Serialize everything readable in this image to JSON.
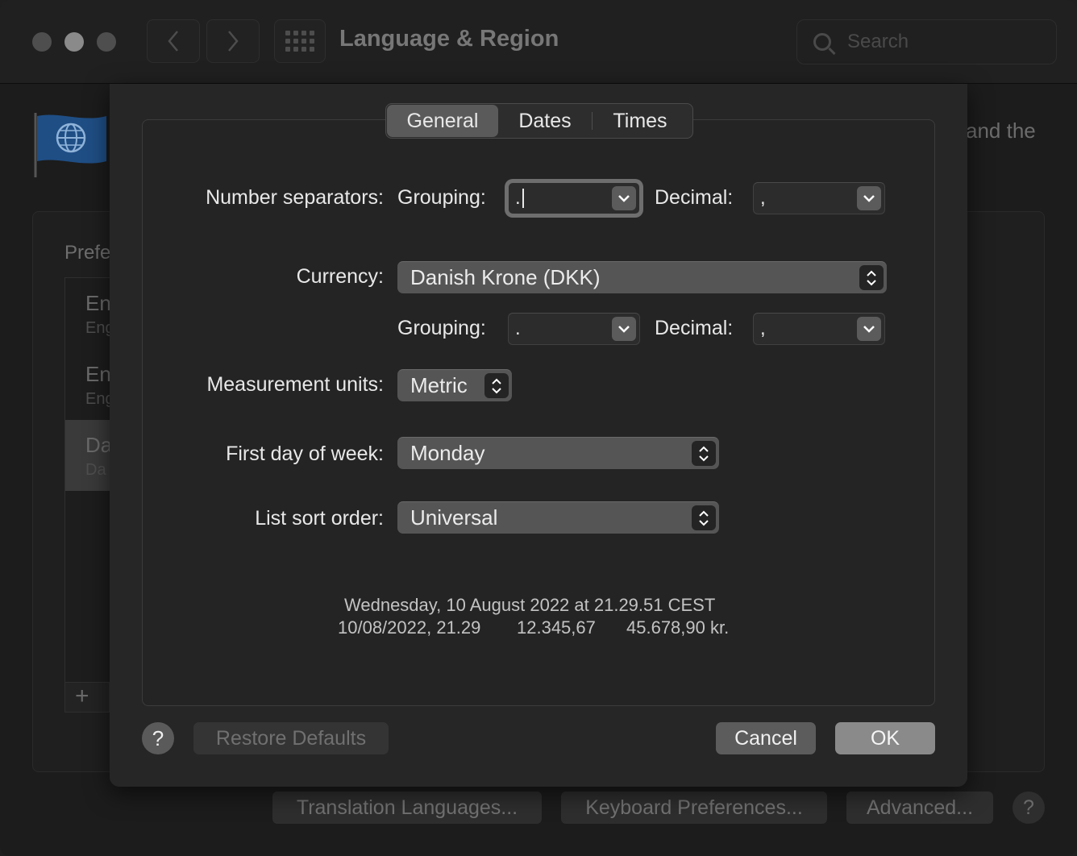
{
  "window": {
    "title": "Language & Region",
    "search_placeholder": "Search",
    "back_icon": "chevron-left-icon",
    "forward_icon": "chevron-right-icon",
    "description_fragment": "and the",
    "preferred_languages_fragment": "Prefe",
    "languages": [
      {
        "label": "En",
        "sub": "Eng"
      },
      {
        "label": "En",
        "sub": "Eng"
      },
      {
        "label": "Da",
        "sub": "Da"
      }
    ],
    "add_label": "+",
    "bottom_buttons": {
      "translation": "Translation Languages...",
      "keyboard": "Keyboard Preferences...",
      "advanced": "Advanced...",
      "help": "?"
    }
  },
  "sheet": {
    "tabs": [
      "General",
      "Dates",
      "Times"
    ],
    "active_tab": "General",
    "number_separators": {
      "label": "Number separators:",
      "grouping_label": "Grouping:",
      "grouping_value": ".",
      "decimal_label": "Decimal:",
      "decimal_value": ","
    },
    "currency": {
      "label": "Currency:",
      "value": "Danish Krone (DKK)",
      "grouping_label": "Grouping:",
      "grouping_value": ".",
      "decimal_label": "Decimal:",
      "decimal_value": ","
    },
    "measurement": {
      "label": "Measurement units:",
      "value": "Metric"
    },
    "first_day": {
      "label": "First day of week:",
      "value": "Monday"
    },
    "sort_order": {
      "label": "List sort order:",
      "value": "Universal"
    },
    "sample": {
      "line1": "Wednesday, 10 August 2022 at 21.29.51 CEST",
      "date_time": "10/08/2022, 21.29",
      "number": "12.345,67",
      "currency": "45.678,90 kr."
    },
    "buttons": {
      "help": "?",
      "restore": "Restore Defaults",
      "cancel": "Cancel",
      "ok": "OK"
    }
  },
  "colors": {
    "window_bg": "#1c1c1c",
    "sheet_bg": "#262626",
    "popup_bg": "#555555",
    "ok_button": "#8a8a8a"
  }
}
